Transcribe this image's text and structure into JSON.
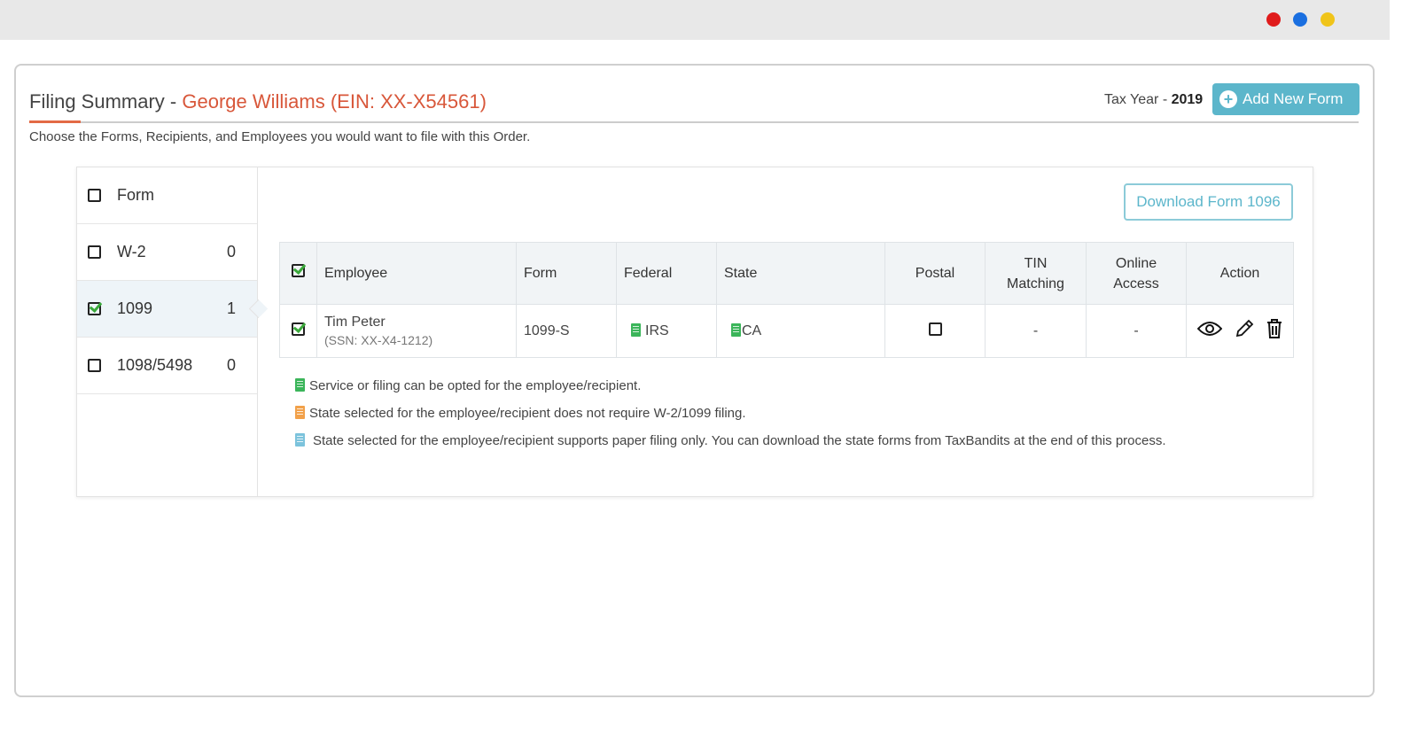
{
  "window": {
    "dots": [
      "#e01b1b",
      "#1a6fe0",
      "#f0c419"
    ]
  },
  "header": {
    "title": "Filing Summary",
    "separator": " - ",
    "org": "George Williams (EIN: XX-X54561)",
    "subtitle": "Choose the Forms, Recipients, and Employees you would want to file with this Order.",
    "tax_year_label": "Tax Year - ",
    "tax_year": "2019",
    "add_button": "Add New Form"
  },
  "forms": [
    {
      "label": "Form",
      "count": null,
      "checked": false
    },
    {
      "label": "W-2",
      "count": "0",
      "checked": false
    },
    {
      "label": "1099",
      "count": "1",
      "checked": true
    },
    {
      "label": "1098/5498",
      "count": "0",
      "checked": false
    }
  ],
  "download_button": "Download Form 1096",
  "table": {
    "headers": [
      "Employee",
      "Form",
      "Federal",
      "State",
      "Postal",
      "TIN\nMatching",
      "Online\nAccess",
      "Action"
    ],
    "tin1": "TIN",
    "tin2": "Matching",
    "online1": "Online",
    "online2": "Access",
    "rows": [
      {
        "name": "Tim Peter",
        "ssn": "(SSN: XX-X4-1212)",
        "form": "1099-S",
        "federal": "IRS",
        "state": "CA",
        "tin": "-",
        "online": "-"
      }
    ]
  },
  "legend": [
    {
      "color": "green",
      "text": "Service or filing can be opted for the employee/recipient."
    },
    {
      "color": "orange",
      "text": "State selected for the employee/recipient does not require W-2/1099 filing."
    },
    {
      "color": "blue",
      "text": "State selected for the employee/recipient supports paper filing only. You can download the state forms from TaxBandits at the end of this process."
    }
  ]
}
